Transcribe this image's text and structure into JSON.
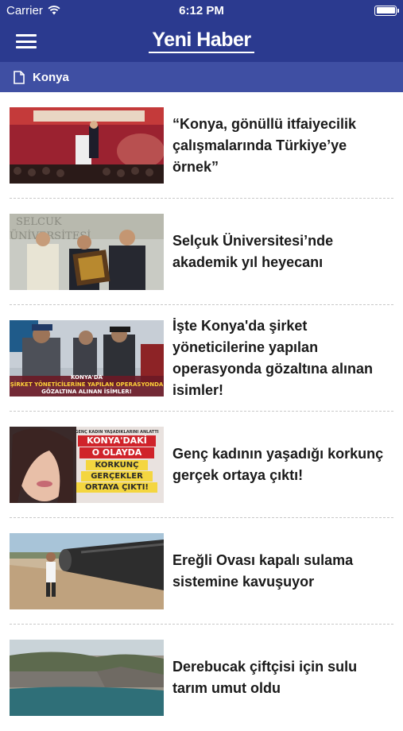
{
  "status_bar": {
    "carrier": "Carrier",
    "time": "6:12 PM"
  },
  "app": {
    "logo": "Yeni Haber"
  },
  "breadcrumb": {
    "label": "Konya"
  },
  "colors": {
    "primary": "#2b3a8f",
    "breadcrumb_bg": "#3f4fa3",
    "separator": "#c8c8c8"
  },
  "articles": [
    {
      "title": "“Konya, gönüllü itfaiyecilik çalışmalarında Türkiye’ye örnek”"
    },
    {
      "title": "Selçuk Üniversitesi’nde akademik yıl heyecanı"
    },
    {
      "title": "İşte Konya'da şirket yöneticilerine yapılan operasyonda gözaltına alınan isimler!",
      "image_caption": {
        "line1": "KONYA'DA",
        "line2": "ŞİRKET YÖNETİCİLERİNE YAPILAN OPERASYONDA",
        "line3": "GÖZALTINA ALINAN İSİMLER!"
      }
    },
    {
      "title": "Genç kadının yaşadığı korkunç gerçek ortaya çıktı!",
      "image_caption": {
        "top": "GENÇ KADIN YAŞADIKLARINI ANLATTI",
        "line1": "KONYA'DAKİ",
        "line2": "O OLAYDA",
        "line3": "KORKUNÇ",
        "line4": "GERÇEKLER",
        "line5": "ORTAYA ÇIKTI!"
      }
    },
    {
      "title": "Ereğli Ovası kapalı sulama sistemine kavuşuyor"
    },
    {
      "title": "Derebucak çiftçisi için sulu tarım umut oldu"
    }
  ]
}
